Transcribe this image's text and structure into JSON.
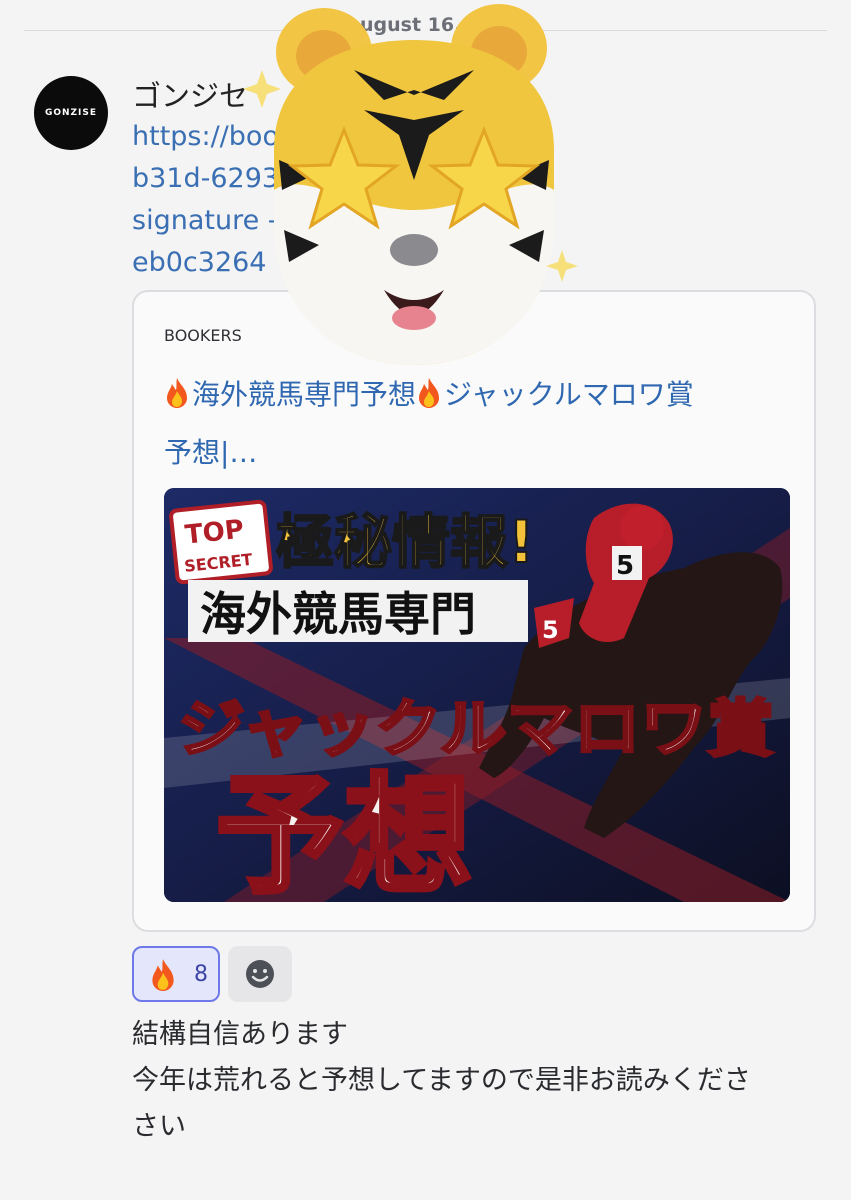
{
  "date_divider": {
    "label": "ugust 16, 20"
  },
  "message": {
    "avatar_text": "GONZISE",
    "author": "ゴンジセ",
    "link_lines": [
      "https://boo                       217c8-510b-431a-",
      "b31d-6293",
      "signature                          -897c-",
      "eb0c3264"
    ],
    "embed": {
      "provider": "BOOKERS",
      "title_line1_a": "海外競馬専門予想",
      "title_line1_b": "ジャックルマロワ賞",
      "title_line2": "予想|…",
      "thumbnail": {
        "badge_top": "TOP",
        "badge_secret": "SECRET",
        "headline": "極秘情報!",
        "subhead": "海外競馬専門",
        "race": "ジャックルマロワ賞",
        "big": "予想",
        "saddle_number": "5"
      }
    },
    "reactions": [
      {
        "emoji": "fire",
        "count": "8"
      }
    ],
    "body_lines": [
      "結構自信あります",
      "今年は荒れると予想してますので是非お読みくださ",
      "さい"
    ]
  },
  "icons": {
    "flame": "fire-emoji-icon",
    "add_reaction": "smile-add-reaction-icon",
    "sticker": "tiger-star-eyes-sticker"
  },
  "colors": {
    "link": "#3a6fb3",
    "reaction_border": "#6f78e8",
    "background": "#f4f4f5"
  }
}
